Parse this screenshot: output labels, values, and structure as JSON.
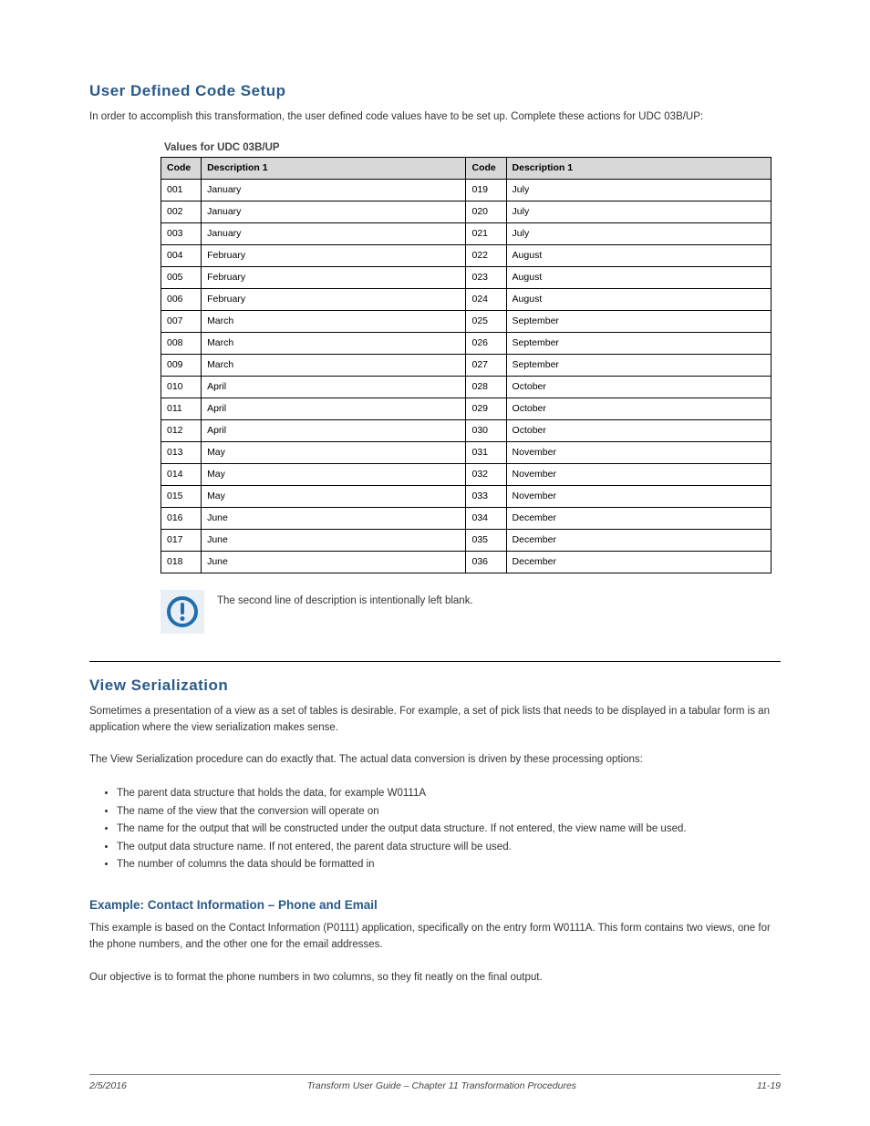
{
  "heading_main": "User Defined Code Setup",
  "intro": "In order to accomplish this transformation, the user defined code values have to be set up. Complete these actions for UDC 03B/UP:",
  "table_title": "Values for UDC 03B/UP",
  "table": {
    "cols": [
      "Code",
      "Description 1",
      "Code",
      "Description 1"
    ],
    "rows": [
      [
        "001",
        "January",
        "019",
        "July"
      ],
      [
        "002",
        "January",
        "020",
        "July"
      ],
      [
        "003",
        "January",
        "021",
        "July"
      ],
      [
        "004",
        "February",
        "022",
        "August"
      ],
      [
        "005",
        "February",
        "023",
        "August"
      ],
      [
        "006",
        "February",
        "024",
        "August"
      ],
      [
        "007",
        "March",
        "025",
        "September"
      ],
      [
        "008",
        "March",
        "026",
        "September"
      ],
      [
        "009",
        "March",
        "027",
        "September"
      ],
      [
        "010",
        "April",
        "028",
        "October"
      ],
      [
        "011",
        "April",
        "029",
        "October"
      ],
      [
        "012",
        "April",
        "030",
        "October"
      ],
      [
        "013",
        "May",
        "031",
        "November"
      ],
      [
        "014",
        "May",
        "032",
        "November"
      ],
      [
        "015",
        "May",
        "033",
        "November"
      ],
      [
        "016",
        "June",
        "034",
        "December"
      ],
      [
        "017",
        "June",
        "035",
        "December"
      ],
      [
        "018",
        "June",
        "036",
        "December"
      ]
    ]
  },
  "note": "The second line of description is intentionally left blank.",
  "section2": {
    "title": "View Serialization",
    "intro_1": "Sometimes a presentation of a view as a set of tables is desirable. For example, a set of pick lists that needs to be displayed in a tabular form is an application where the view serialization makes sense.",
    "intro_2": "The View Serialization procedure can do exactly that. The actual data conversion is driven by these processing options:",
    "bullets": [
      "The parent data structure that holds the data, for example W0111A",
      "The name of the view that the conversion will operate on",
      "The name for the output that will be constructed under the output data structure. If not entered, the view name will be used.",
      "The output data structure name. If not entered, the parent data structure will be used.",
      "The number of columns the data should be formatted in"
    ],
    "example_sub": "Example: Contact Information – Phone and Email",
    "example_p1": "This example is based on the Contact Information (P0111) application, specifically on the entry form W0111A. This form contains two views, one for the phone numbers, and the other one for the email addresses.",
    "example_p2": "Our objective is to format the phone numbers in two columns, so they fit neatly on the final output."
  },
  "footer": {
    "left": "2/5/2016",
    "center_1": "Transform User Guide –",
    "center_2": "Chapter 11 Transformation Procedures",
    "right": "11-19"
  }
}
